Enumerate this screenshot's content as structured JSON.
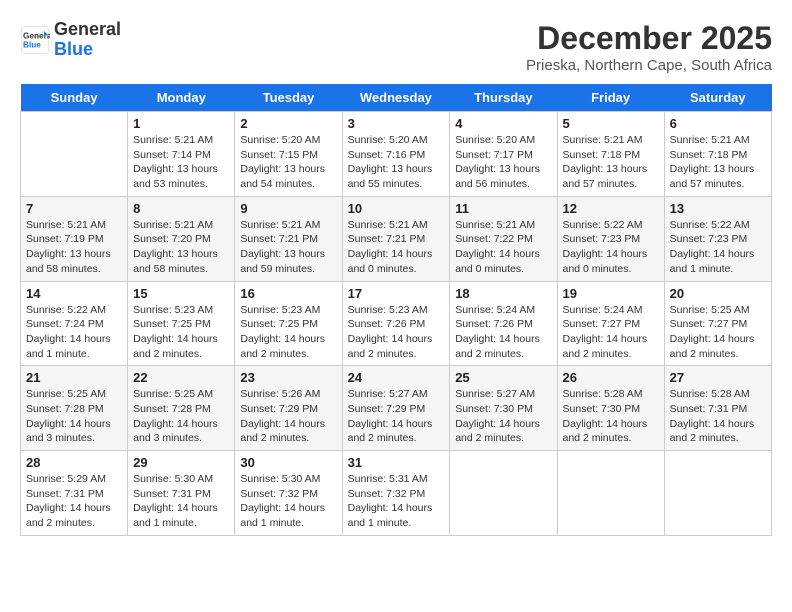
{
  "header": {
    "logo_line1": "General",
    "logo_line2": "Blue",
    "month": "December 2025",
    "location": "Prieska, Northern Cape, South Africa"
  },
  "days_of_week": [
    "Sunday",
    "Monday",
    "Tuesday",
    "Wednesday",
    "Thursday",
    "Friday",
    "Saturday"
  ],
  "weeks": [
    [
      {
        "day": "",
        "info": ""
      },
      {
        "day": "1",
        "info": "Sunrise: 5:21 AM\nSunset: 7:14 PM\nDaylight: 13 hours\nand 53 minutes."
      },
      {
        "day": "2",
        "info": "Sunrise: 5:20 AM\nSunset: 7:15 PM\nDaylight: 13 hours\nand 54 minutes."
      },
      {
        "day": "3",
        "info": "Sunrise: 5:20 AM\nSunset: 7:16 PM\nDaylight: 13 hours\nand 55 minutes."
      },
      {
        "day": "4",
        "info": "Sunrise: 5:20 AM\nSunset: 7:17 PM\nDaylight: 13 hours\nand 56 minutes."
      },
      {
        "day": "5",
        "info": "Sunrise: 5:21 AM\nSunset: 7:18 PM\nDaylight: 13 hours\nand 57 minutes."
      },
      {
        "day": "6",
        "info": "Sunrise: 5:21 AM\nSunset: 7:18 PM\nDaylight: 13 hours\nand 57 minutes."
      }
    ],
    [
      {
        "day": "7",
        "info": "Sunrise: 5:21 AM\nSunset: 7:19 PM\nDaylight: 13 hours\nand 58 minutes."
      },
      {
        "day": "8",
        "info": "Sunrise: 5:21 AM\nSunset: 7:20 PM\nDaylight: 13 hours\nand 58 minutes."
      },
      {
        "day": "9",
        "info": "Sunrise: 5:21 AM\nSunset: 7:21 PM\nDaylight: 13 hours\nand 59 minutes."
      },
      {
        "day": "10",
        "info": "Sunrise: 5:21 AM\nSunset: 7:21 PM\nDaylight: 14 hours\nand 0 minutes."
      },
      {
        "day": "11",
        "info": "Sunrise: 5:21 AM\nSunset: 7:22 PM\nDaylight: 14 hours\nand 0 minutes."
      },
      {
        "day": "12",
        "info": "Sunrise: 5:22 AM\nSunset: 7:23 PM\nDaylight: 14 hours\nand 0 minutes."
      },
      {
        "day": "13",
        "info": "Sunrise: 5:22 AM\nSunset: 7:23 PM\nDaylight: 14 hours\nand 1 minute."
      }
    ],
    [
      {
        "day": "14",
        "info": "Sunrise: 5:22 AM\nSunset: 7:24 PM\nDaylight: 14 hours\nand 1 minute."
      },
      {
        "day": "15",
        "info": "Sunrise: 5:23 AM\nSunset: 7:25 PM\nDaylight: 14 hours\nand 2 minutes."
      },
      {
        "day": "16",
        "info": "Sunrise: 5:23 AM\nSunset: 7:25 PM\nDaylight: 14 hours\nand 2 minutes."
      },
      {
        "day": "17",
        "info": "Sunrise: 5:23 AM\nSunset: 7:26 PM\nDaylight: 14 hours\nand 2 minutes."
      },
      {
        "day": "18",
        "info": "Sunrise: 5:24 AM\nSunset: 7:26 PM\nDaylight: 14 hours\nand 2 minutes."
      },
      {
        "day": "19",
        "info": "Sunrise: 5:24 AM\nSunset: 7:27 PM\nDaylight: 14 hours\nand 2 minutes."
      },
      {
        "day": "20",
        "info": "Sunrise: 5:25 AM\nSunset: 7:27 PM\nDaylight: 14 hours\nand 2 minutes."
      }
    ],
    [
      {
        "day": "21",
        "info": "Sunrise: 5:25 AM\nSunset: 7:28 PM\nDaylight: 14 hours\nand 3 minutes."
      },
      {
        "day": "22",
        "info": "Sunrise: 5:25 AM\nSunset: 7:28 PM\nDaylight: 14 hours\nand 3 minutes."
      },
      {
        "day": "23",
        "info": "Sunrise: 5:26 AM\nSunset: 7:29 PM\nDaylight: 14 hours\nand 2 minutes."
      },
      {
        "day": "24",
        "info": "Sunrise: 5:27 AM\nSunset: 7:29 PM\nDaylight: 14 hours\nand 2 minutes."
      },
      {
        "day": "25",
        "info": "Sunrise: 5:27 AM\nSunset: 7:30 PM\nDaylight: 14 hours\nand 2 minutes."
      },
      {
        "day": "26",
        "info": "Sunrise: 5:28 AM\nSunset: 7:30 PM\nDaylight: 14 hours\nand 2 minutes."
      },
      {
        "day": "27",
        "info": "Sunrise: 5:28 AM\nSunset: 7:31 PM\nDaylight: 14 hours\nand 2 minutes."
      }
    ],
    [
      {
        "day": "28",
        "info": "Sunrise: 5:29 AM\nSunset: 7:31 PM\nDaylight: 14 hours\nand 2 minutes."
      },
      {
        "day": "29",
        "info": "Sunrise: 5:30 AM\nSunset: 7:31 PM\nDaylight: 14 hours\nand 1 minute."
      },
      {
        "day": "30",
        "info": "Sunrise: 5:30 AM\nSunset: 7:32 PM\nDaylight: 14 hours\nand 1 minute."
      },
      {
        "day": "31",
        "info": "Sunrise: 5:31 AM\nSunset: 7:32 PM\nDaylight: 14 hours\nand 1 minute."
      },
      {
        "day": "",
        "info": ""
      },
      {
        "day": "",
        "info": ""
      },
      {
        "day": "",
        "info": ""
      }
    ]
  ]
}
